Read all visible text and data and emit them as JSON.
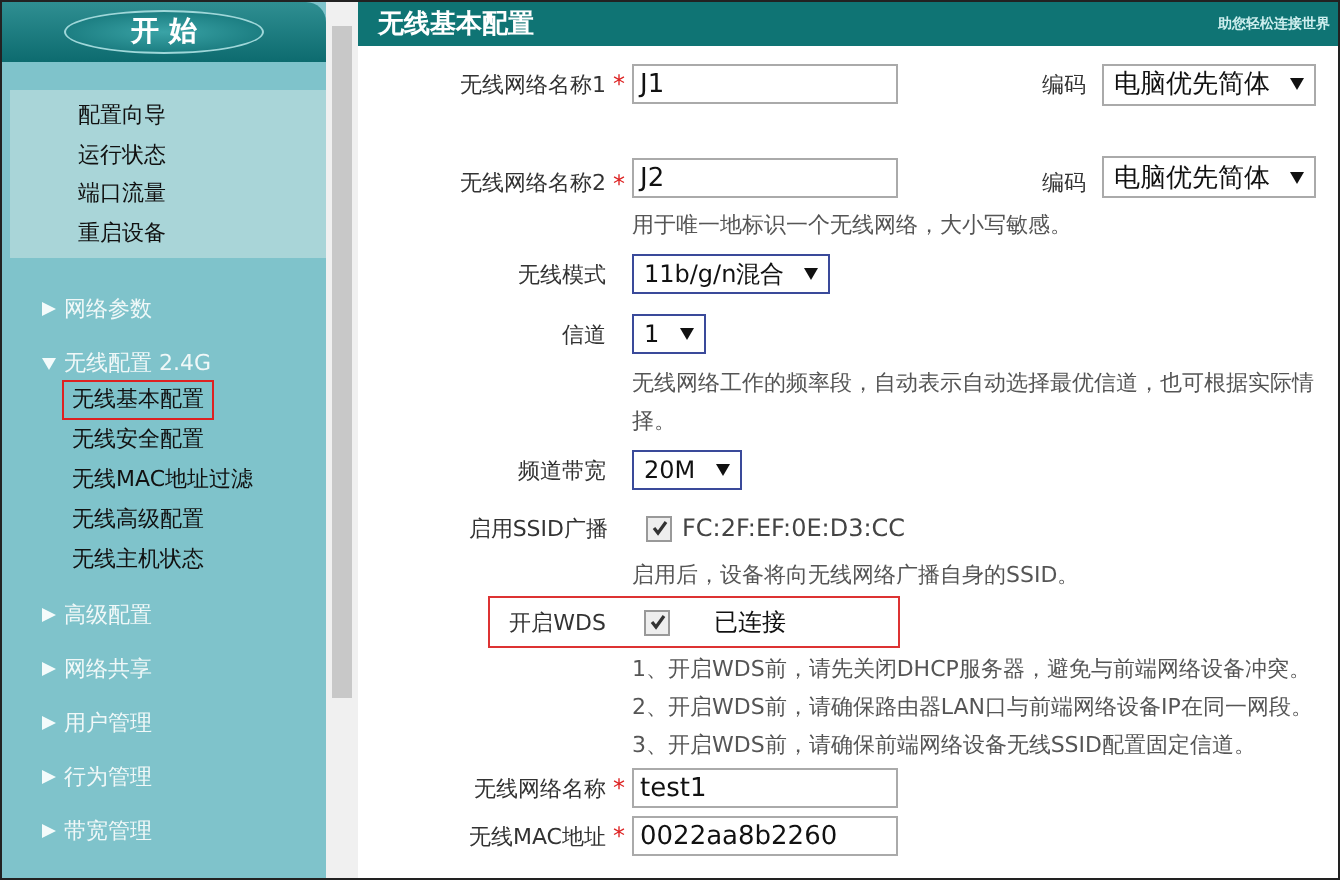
{
  "sidebar": {
    "start_button": "开 始",
    "quick_links": [
      "配置向导",
      "运行状态",
      "端口流量",
      "重启设备"
    ],
    "sections": [
      {
        "label": "网络参数",
        "expanded": false
      },
      {
        "label": "无线配置 2.4G",
        "expanded": true,
        "children": [
          {
            "label": "无线基本配置",
            "selected": true
          },
          {
            "label": "无线安全配置",
            "selected": false
          },
          {
            "label": "无线MAC地址过滤",
            "selected": false
          },
          {
            "label": "无线高级配置",
            "selected": false
          },
          {
            "label": "无线主机状态",
            "selected": false
          }
        ]
      },
      {
        "label": "高级配置",
        "expanded": false
      },
      {
        "label": "网络共享",
        "expanded": false
      },
      {
        "label": "用户管理",
        "expanded": false
      },
      {
        "label": "行为管理",
        "expanded": false
      },
      {
        "label": "带宽管理",
        "expanded": false
      }
    ]
  },
  "header": {
    "title": "无线基本配置",
    "slogan": "助您轻松连接世界"
  },
  "form": [
    {
      "kind": "name_encoding",
      "label": "无线网络名称1",
      "required_mark": "*",
      "value": "J1",
      "encoding_label": "编码",
      "encoding": "电脑优先简体"
    },
    {
      "kind": "name_encoding",
      "label": "无线网络名称2",
      "required_mark": "*",
      "value": "J2",
      "encoding_label": "编码",
      "encoding": "电脑优先简体"
    },
    {
      "kind": "note",
      "lines": [
        "用于唯一地标识一个无线网络，大小写敏感。"
      ]
    },
    {
      "kind": "select",
      "label": "无线模式",
      "value": "11b/g/n混合"
    },
    {
      "kind": "select",
      "label": "信道",
      "value": "1"
    },
    {
      "kind": "note",
      "lines": [
        "无线网络工作的频率段，自动表示自动选择最优信道，也可根据实际情",
        "择。"
      ]
    },
    {
      "kind": "select",
      "label": "频道带宽",
      "value": "20M"
    },
    {
      "kind": "checkbox",
      "label": "启用SSID广播",
      "checked": true,
      "text": "FC:2F:EF:0E:D3:CC",
      "highlighted": false
    },
    {
      "kind": "note",
      "lines": [
        "启用后，设备将向无线网络广播自身的SSID。"
      ]
    },
    {
      "kind": "checkbox",
      "label": "开启WDS",
      "checked": true,
      "text": "已连接",
      "highlighted": true
    },
    {
      "kind": "note",
      "lines": [
        "1、开启WDS前，请先关闭DHCP服务器，避免与前端网络设备冲突。",
        "2、开启WDS前，请确保路由器LAN口与前端网络设备IP在同一网段。",
        "3、开启WDS前，请确保前端网络设备无线SSID配置固定信道。"
      ]
    },
    {
      "kind": "text",
      "label": "无线网络名称",
      "required_mark": "*",
      "value": "test1"
    },
    {
      "kind": "text",
      "label": "无线MAC地址",
      "required_mark": "*",
      "value": "0022aa8b2260"
    }
  ]
}
